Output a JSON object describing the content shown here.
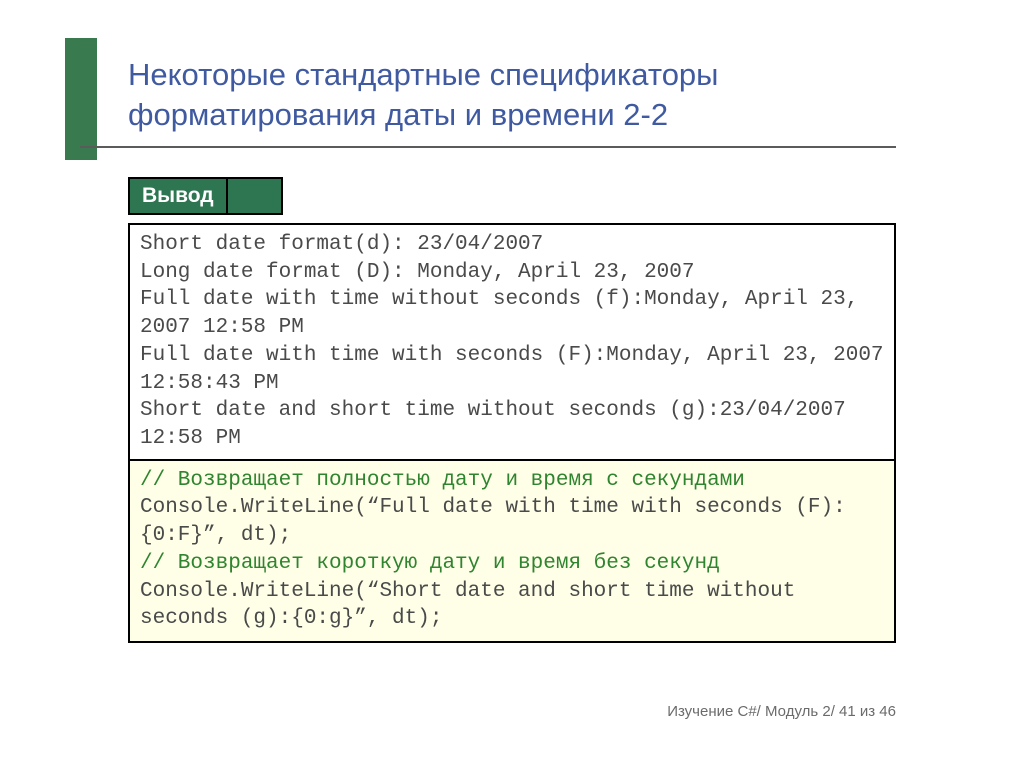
{
  "title": "Некоторые стандартные спецификаторы форматирования даты и времени 2-2",
  "output_label": "Вывод",
  "output": "Short date format(d): 23/04/2007\nLong date format (D): Monday, April 23, 2007\nFull date with time without seconds (f):Monday, April 23, 2007 12:58 PM\nFull date with time with seconds (F):Monday, April 23, 2007 12:58:43 PM\nShort date and short time without seconds (g):23/04/2007 12:58 PM",
  "code": {
    "comment1": "// Возвращает полностью дату и время с секундами",
    "line1": "Console.WriteLine(“Full date with time with seconds (F):{0:F}”, dt);",
    "comment2": "// Возвращает короткую дату и время без секунд",
    "line2": "Console.WriteLine(“Short date and short time without seconds (g):{0:g}”, dt);"
  },
  "footer": "Изучение C#/ Модуль 2/ 41 из 46"
}
